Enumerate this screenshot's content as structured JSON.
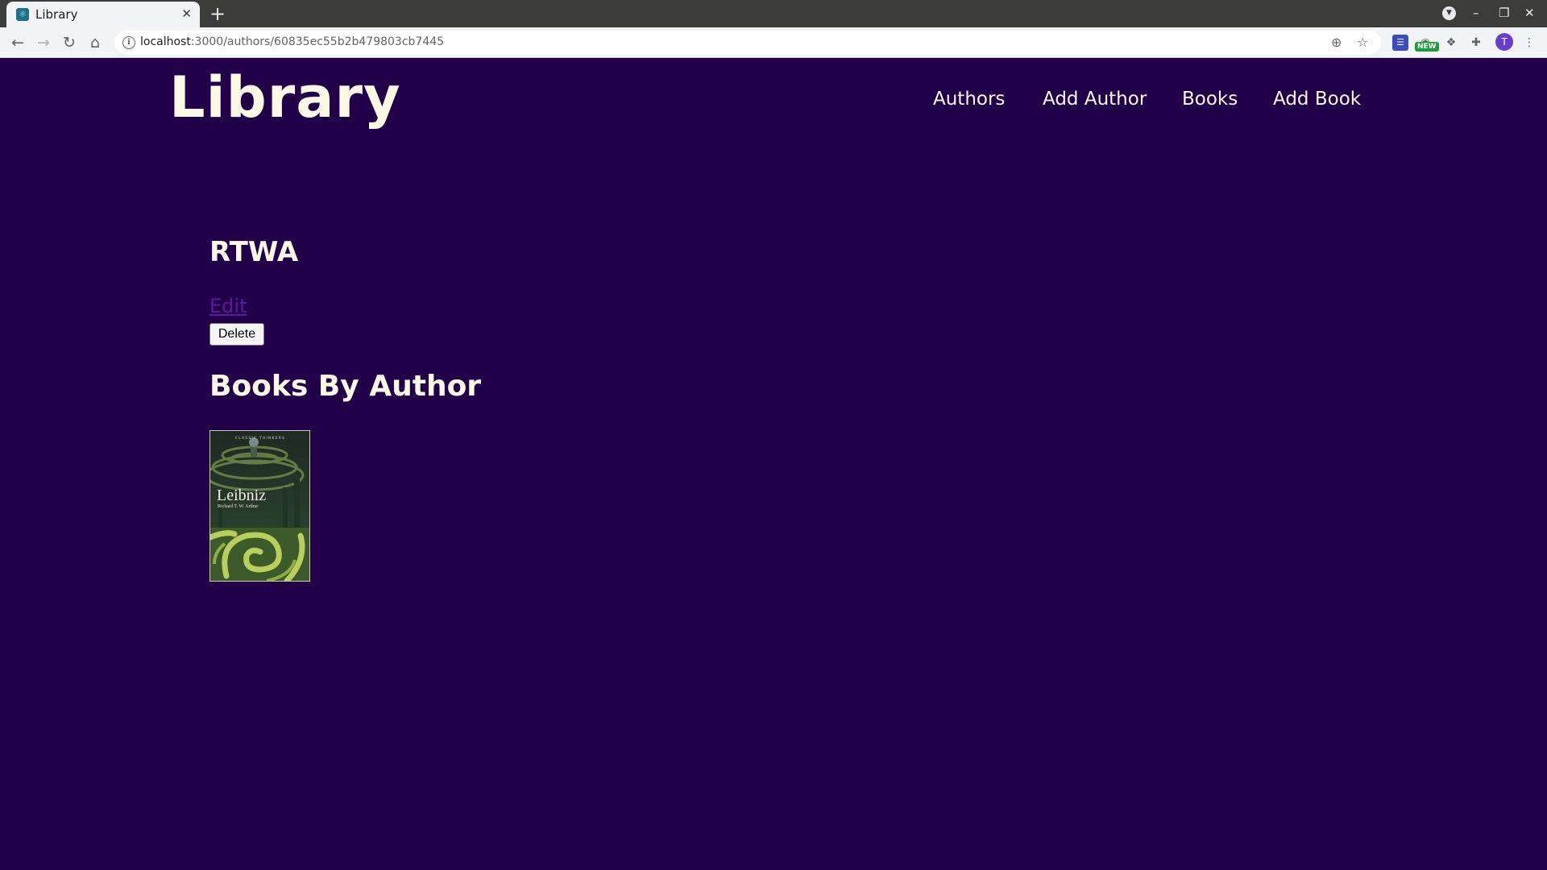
{
  "browser": {
    "tab_title": "Library",
    "tab_close": "✕",
    "new_tab": "+",
    "url_host": "localhost",
    "url_path": ":3000/authors/60835ec55b2b479803cb7445",
    "ext_new_badge": "NEW",
    "profile_initial": "T",
    "icons": {
      "back": "←",
      "forward": "→",
      "reload": "↻",
      "home": "⌂",
      "zoom": "⊕",
      "star": "☆",
      "extensions": "✚",
      "menu": "⋮",
      "minimize": "–",
      "restore": "❐",
      "close": "✕",
      "tab_search": "▼"
    }
  },
  "header": {
    "brand": "Library",
    "nav": [
      "Authors",
      "Add Author",
      "Books",
      "Add Book"
    ]
  },
  "author": {
    "name": "RTWA",
    "edit_label": "Edit",
    "delete_label": "Delete"
  },
  "books_section": {
    "title": "Books By Author",
    "books": [
      {
        "cover_title": "Leibniz",
        "cover_author": "Richard T. W. Arthur",
        "cover_series": "CLASSIC THINKERS"
      }
    ]
  },
  "colors": {
    "page_bg": "#210049",
    "text": "#fdf8e4",
    "link": "#5b1aa0"
  }
}
